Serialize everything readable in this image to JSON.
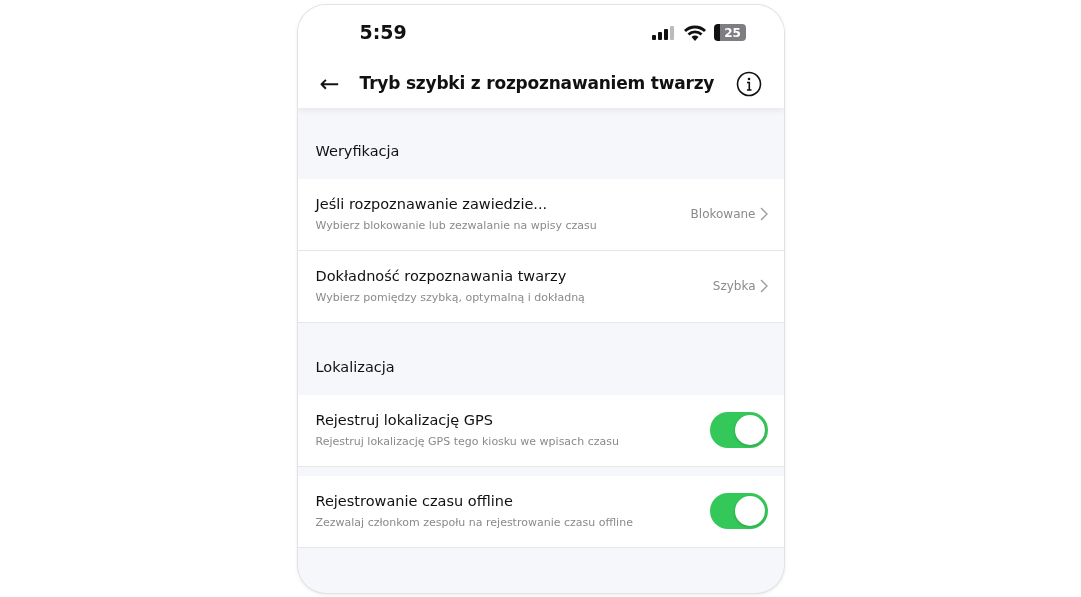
{
  "status_bar": {
    "time": "5:59",
    "battery": "25"
  },
  "header": {
    "back": "←",
    "title": "Tryb szybki z rozpoznawaniem twarzy"
  },
  "sections": [
    {
      "title": "Weryfikacja",
      "rows": [
        {
          "kind": "link",
          "title": "Jeśli rozpoznawanie zawiedzie...",
          "subtitle": "Wybierz blokowanie lub zezwalanie na wpisy czasu",
          "value": "Blokowane"
        },
        {
          "kind": "link",
          "title": "Dokładność rozpoznawania twarzy",
          "subtitle": "Wybierz pomiędzy szybką, optymalną i dokładną",
          "value": "Szybka"
        }
      ]
    },
    {
      "title": "Lokalizacja",
      "rows": [
        {
          "kind": "toggle",
          "title": "Rejestruj lokalizację GPS",
          "subtitle": "Rejestruj lokalizację GPS tego kiosku we wpisach czasu",
          "on": true
        },
        {
          "kind": "toggle",
          "title": "Rejestrowanie czasu offline",
          "subtitle": "Zezwalaj członkom zespołu na rejestrowanie czasu offline",
          "on": true
        }
      ]
    }
  ]
}
